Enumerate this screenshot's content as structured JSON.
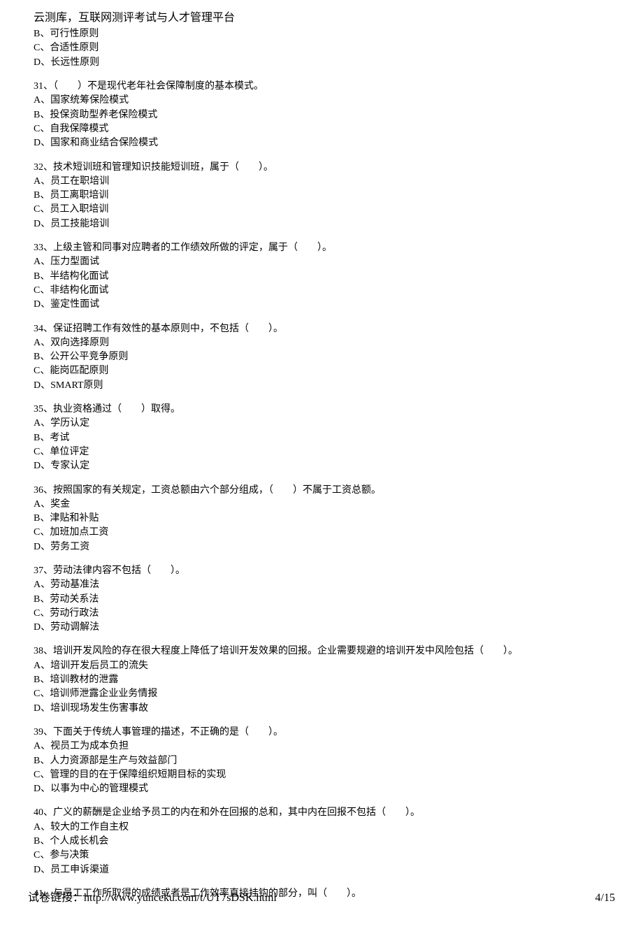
{
  "header": "云测库，互联网测评考试与人才管理平台",
  "orphan_opts": [
    "B、可行性原则",
    "C、合适性原则",
    "D、长远性原则"
  ],
  "questions": [
    {
      "q": "31、（　　）不是现代老年社会保障制度的基本模式。",
      "opts": [
        "A、国家统筹保险模式",
        "B、投保资助型养老保险模式",
        "C、自我保障模式",
        "D、国家和商业结合保险模式"
      ]
    },
    {
      "q": "32、技术短训班和管理知识技能短训班，属于（　　）。",
      "opts": [
        "A、员工在职培训",
        "B、员工离职培训",
        "C、员工入职培训",
        "D、员工技能培训"
      ]
    },
    {
      "q": "33、上级主管和同事对应聘者的工作绩效所做的评定，属于（　　）。",
      "opts": [
        "A、压力型面试",
        "B、半结构化面试",
        "C、非结构化面试",
        "D、鉴定性面试"
      ]
    },
    {
      "q": "34、保证招聘工作有效性的基本原则中，不包括（　　）。",
      "opts": [
        "A、双向选择原则",
        "B、公开公平竞争原则",
        "C、能岗匹配原则",
        "D、SMART原则"
      ]
    },
    {
      "q": "35、执业资格通过（　　）取得。",
      "opts": [
        "A、学历认定",
        "B、考试",
        "C、单位评定",
        "D、专家认定"
      ]
    },
    {
      "q": "36、按照国家的有关规定，工资总额由六个部分组成，（　　）不属于工资总额。",
      "opts": [
        "A、奖金",
        "B、津贴和补贴",
        "C、加班加点工资",
        "D、劳务工资"
      ]
    },
    {
      "q": "37、劳动法律内容不包括（　　）。",
      "opts": [
        "A、劳动基准法",
        "B、劳动关系法",
        "C、劳动行政法",
        "D、劳动调解法"
      ]
    },
    {
      "q": "38、培训开发风险的存在很大程度上降低了培训开发效果的回报。企业需要规避的培训开发中风险包括（　　）。",
      "opts": [
        "A、培训开发后员工的流失",
        "B、培训教材的泄露",
        "C、培训师泄露企业业务情报",
        "D、培训现场发生伤害事故"
      ]
    },
    {
      "q": "39、下面关于传统人事管理的描述，不正确的是（　　）。",
      "opts": [
        "A、视员工为成本负担",
        "B、人力资源部是生产与效益部门",
        "C、管理的目的在于保障组织短期目标的实现",
        "D、以事为中心的管理模式"
      ]
    },
    {
      "q": "40、广义的薪酬是企业给予员工的内在和外在回报的总和，其中内在回报不包括（　　）。",
      "opts": [
        "A、较大的工作自主权",
        "B、个人成长机会",
        "C、参与决策",
        "D、员工申诉渠道"
      ]
    },
    {
      "q": "41、与员工工作所取得的成绩或者是工作效率直接挂钩的部分，叫（　　）。",
      "opts": []
    }
  ],
  "footer": {
    "link_label": "试卷链接：http://www.yunceku.com/t/UT7sDSK.html",
    "page": "4/15"
  }
}
